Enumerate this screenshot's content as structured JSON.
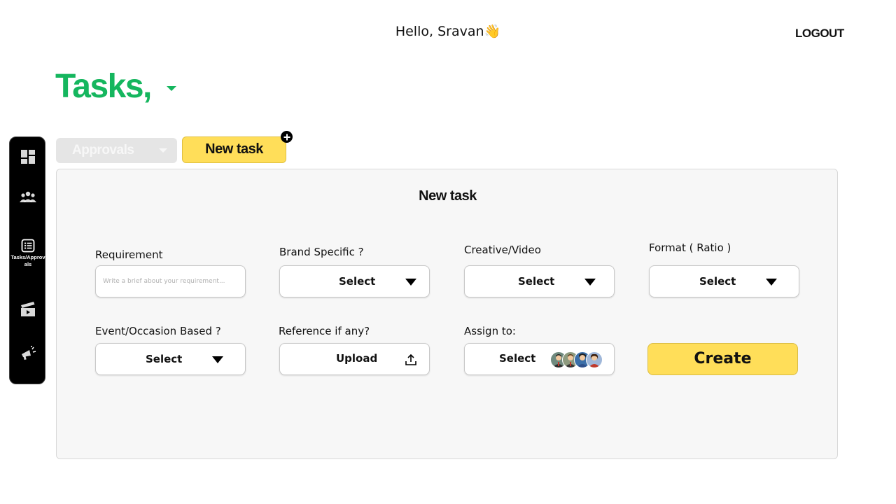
{
  "header": {
    "greeting": "Hello, Sravan👋",
    "logout_label": "LOGOUT"
  },
  "page": {
    "title": "Tasks,"
  },
  "sidebar": {
    "items": [
      {
        "icon": "dashboard-icon",
        "label": ""
      },
      {
        "icon": "team-icon",
        "label": ""
      },
      {
        "icon": "task-list-icon",
        "label": "Tasks/Approvals"
      },
      {
        "icon": "clapperboard-icon",
        "label": ""
      },
      {
        "icon": "megaphone-icon",
        "label": ""
      }
    ]
  },
  "tabs": {
    "approvals_label": "Approvals",
    "new_task_label": "New task"
  },
  "form": {
    "title": "New task",
    "requirement": {
      "label": "Requirement",
      "placeholder": "Write a brief about your requirement..."
    },
    "brand_specific": {
      "label": "Brand Specific ?",
      "value": "Select"
    },
    "creative_video": {
      "label": "Creative/Video",
      "value": "Select"
    },
    "format_ratio": {
      "label": "Format ( Ratio )",
      "value": "Select"
    },
    "event_occasion": {
      "label": "Event/Occasion Based ?",
      "value": "Select"
    },
    "reference": {
      "label": "Reference if any?",
      "value": "Upload"
    },
    "assign_to": {
      "label": "Assign to:",
      "value": "Select"
    },
    "create_label": "Create"
  },
  "colors": {
    "accent_green": "#15b65e",
    "accent_yellow": "#ffde59",
    "sidebar_bg": "#000000"
  }
}
